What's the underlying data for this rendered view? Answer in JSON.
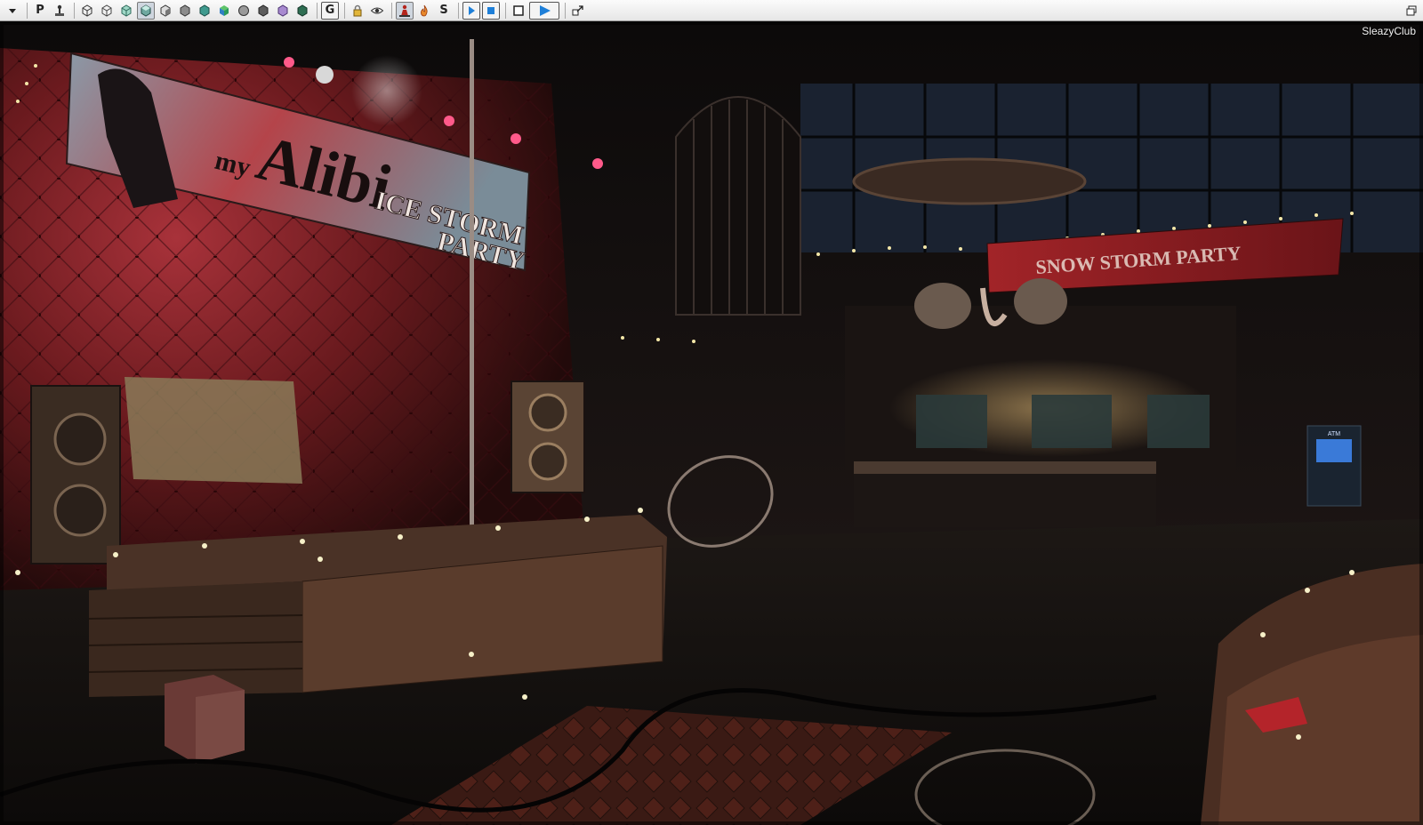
{
  "toolbar": {
    "dropdown_icon": "chevron-down-icon",
    "perspective_label": "P",
    "group_label": "G",
    "shaded_label": "S",
    "accent_play": "#1e7fd8"
  },
  "viewport": {
    "map_name": "SleazyClub",
    "main_banner": {
      "brand_small": "my",
      "brand_large": "Alibi",
      "line1": "ICE STORM",
      "line2": "PARTY"
    },
    "bar_banner": {
      "line1": "SNOW STORM PARTY"
    },
    "atm_label": "ATM"
  }
}
